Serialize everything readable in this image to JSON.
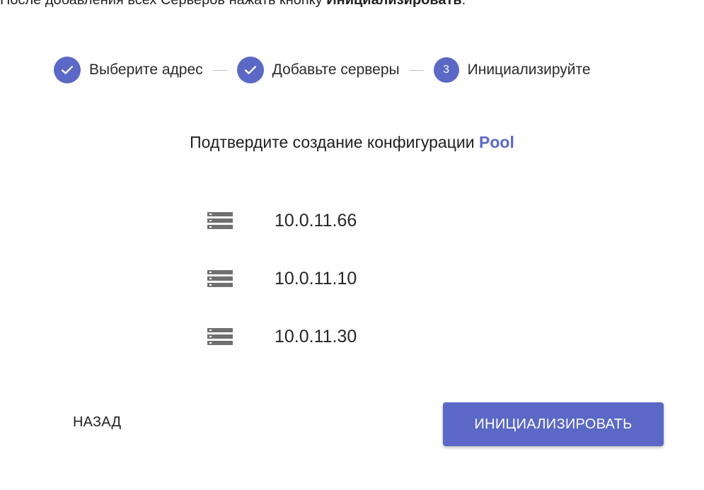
{
  "instruction": {
    "text_before": "После добавления всех Серверов нажать кнопку ",
    "bold_text": "Инициализировать",
    "text_after": "."
  },
  "stepper": {
    "steps": [
      {
        "label": "Выберите адрес",
        "state": "completed",
        "icon": "check-icon"
      },
      {
        "label": "Добавьте серверы",
        "state": "completed",
        "icon": "check-icon"
      },
      {
        "label": "Инициализируйте",
        "state": "active",
        "number": "3"
      }
    ]
  },
  "confirm": {
    "prefix": "Подтвердите создание конфигурации ",
    "config_name": "Pool"
  },
  "servers": [
    {
      "address": "10.0.11.66",
      "icon": "server-icon"
    },
    {
      "address": "10.0.11.10",
      "icon": "server-icon"
    },
    {
      "address": "10.0.11.30",
      "icon": "server-icon"
    }
  ],
  "actions": {
    "back_label": "НАЗАД",
    "init_label": "ИНИЦИАЛИЗИРОВАТЬ"
  },
  "colors": {
    "accent": "#5b68c5",
    "icon_gray": "#707070",
    "connector": "#bdbdbd"
  }
}
